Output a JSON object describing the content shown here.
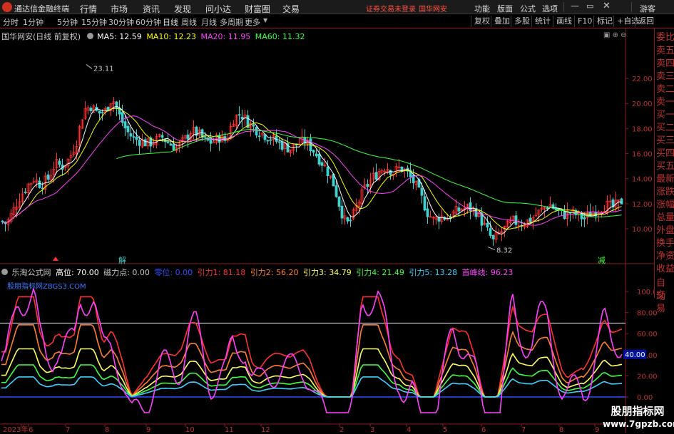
{
  "app": {
    "title": "通达信金融终端",
    "menus": [
      "行情",
      "市场",
      "资讯",
      "发现",
      "问小达",
      "财富圈",
      "交易"
    ],
    "login_status": "证券交易未登录",
    "stock_name": "国华网安",
    "right_menus": [
      "功能",
      "版面",
      "公式",
      "选项"
    ],
    "guest": "游客"
  },
  "toolbar": {
    "periods": [
      "分时",
      "1分钟",
      "5分钟",
      "15分钟",
      "30分钟",
      "60分钟",
      "日线",
      "周线",
      "月线",
      "多周期",
      "更多"
    ],
    "active_period": "日线",
    "buttons": [
      "复权",
      "叠加",
      "多股",
      "统计",
      "画线",
      "F10",
      "标记",
      "+自选",
      "返回"
    ]
  },
  "main_chart": {
    "stock": "国华网安(日线 前复权)",
    "ma": [
      {
        "label": "MA5: 12.59",
        "color": "#ffffff"
      },
      {
        "label": "MA10: 12.23",
        "color": "#ffff00"
      },
      {
        "label": "MA20: 11.95",
        "color": "#ff40ff"
      },
      {
        "label": "MA60: 11.32",
        "color": "#40ff40"
      }
    ],
    "high_label": "23.11",
    "low_label": "8.32",
    "marker_jie": "解",
    "marker_jian": "减",
    "y_ticks": [
      "22.00",
      "20.00",
      "18.00",
      "16.00",
      "14.00",
      "12.00",
      "10.00"
    ]
  },
  "sub_chart": {
    "name": "乐淘公式网",
    "fields": [
      {
        "label": "高位: 70.00",
        "color": "#ffffff"
      },
      {
        "label": "磁力点: 0.00",
        "color": "#c8c8c8"
      },
      {
        "label": "零位: 0.00",
        "color": "#3050ff"
      },
      {
        "label": "引力1: 81.18",
        "color": "#ff3030"
      },
      {
        "label": "引力2: 56.20",
        "color": "#ff8030"
      },
      {
        "label": "引力3: 34.79",
        "color": "#ffff60"
      },
      {
        "label": "引力4: 21.49",
        "color": "#40ff40"
      },
      {
        "label": "引力5: 13.28",
        "color": "#40d0ff"
      },
      {
        "label": "首峰线: 96.23",
        "color": "#ff40ff"
      }
    ],
    "watermark": "股朋指标网ZBGS3.COM",
    "y_ticks": [
      "100.00",
      "80.00",
      "60.00",
      "40.00",
      "20.00",
      "0.00"
    ],
    "level_label": "40.00"
  },
  "x_axis": [
    "2023年",
    "6",
    "7",
    "8",
    "9",
    "10",
    "11",
    "12",
    "2",
    "3",
    "4",
    "5",
    "6",
    "7",
    "8",
    "9"
  ],
  "right_panel": [
    "委比",
    "卖五",
    "卖四",
    "卖三",
    "卖二",
    "卖一",
    "买一",
    "买二",
    "买三",
    "买四",
    "买五",
    "最新",
    "涨跌",
    "涨幅",
    "总量",
    "外盘",
    "换手",
    "净资",
    "收益"
  ],
  "right_panel_lower": [
    "自动",
    "交易"
  ],
  "brand": {
    "cn": "股朋指标网",
    "url": "www.7gpzb.com"
  }
}
